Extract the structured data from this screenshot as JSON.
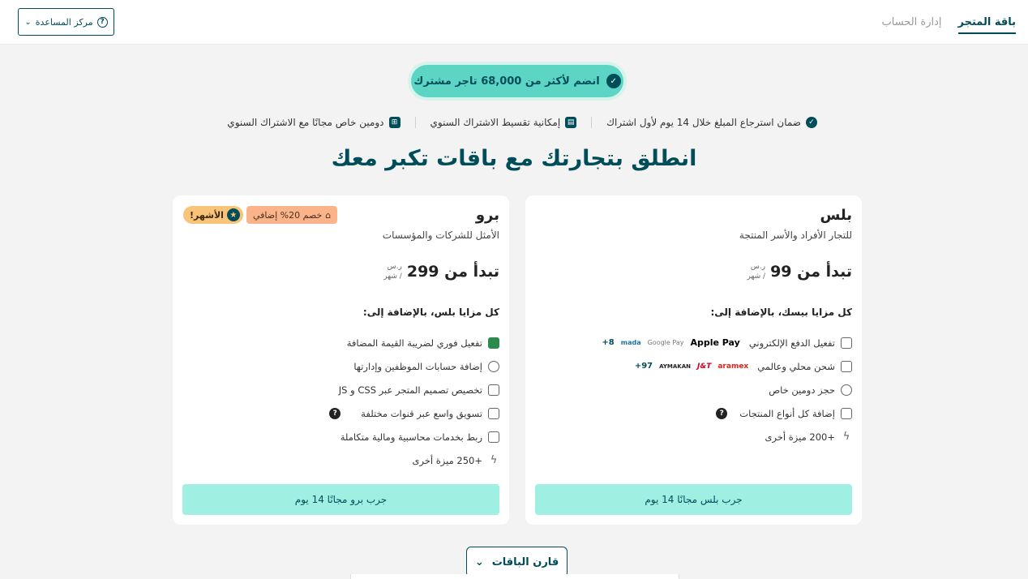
{
  "topbar": {
    "tabs": [
      {
        "label": "باقة المتجر",
        "active": true
      },
      {
        "label": "إدارة الحساب",
        "active": false
      }
    ],
    "help_label": "مركز المساعدة"
  },
  "join_pill": "انضم لأكثر من 68,000 تاجر مشترك",
  "guarantees": [
    "ضمان استرجاع المبلغ خلال 14 يوم لأول اشتراك",
    "إمكانية تقسيط الاشتراك السنوي",
    "دومين خاص مجانًا مع الاشتراك السنوي"
  ],
  "headline": "انطلق بتجارتك مع باقات تكبر معك",
  "plans": {
    "plus": {
      "name": "بلس",
      "subtitle": "للتجار الأفراد والأسر المنتجة",
      "price": "تبدأ من 99",
      "currency": "ر.س",
      "period": "/ شهر",
      "features_title": "كل مزايا بيسك، بالإضافة إلى:",
      "features": [
        "تفعيل الدفع الإلكتروني",
        "شحن محلي وعالمي",
        "حجز دومين خاص",
        "إضافة كل أنواع المنتجات",
        "+200 ميزة أخرى"
      ],
      "payment_logos": [
        "Apple Pay",
        "Google Pay",
        "mada",
        "+8"
      ],
      "shipping_logos": [
        "aramex",
        "J&T",
        "AYMAKAN",
        "+97"
      ],
      "cta": "جرب بلس مجانًا 14 يوم"
    },
    "pro": {
      "name": "برو",
      "subtitle": "الأمثل للشركات والمؤسسات",
      "price": "تبدأ من 299",
      "currency": "ر.س",
      "period": "/ شهر",
      "discount_tag": "خصم 20% إضافي",
      "popular_tag": "الأشهر!",
      "features_title": "كل مزايا بلس، بالإضافة إلى:",
      "features": [
        "تفعيل فوري لضريبة القيمة المضافة",
        "إضافة حسابات الموظفين وإدارتها",
        "تخصيص تصميم المتجر عبر CSS و JS",
        "تسويق واسع عبر قنوات مختلفة",
        "ربط بخدمات محاسبية ومالية متكاملة",
        "+250 ميزة أخرى"
      ],
      "cta": "جرب برو مجانًا 14 يوم"
    }
  },
  "compare_label": "قارن الباقات",
  "colors": {
    "primary": "#004d5a",
    "accent": "#5dd5c4",
    "cta": "#9ff0e2",
    "discount": "#fbb48a",
    "popular": "#f9c47a"
  }
}
